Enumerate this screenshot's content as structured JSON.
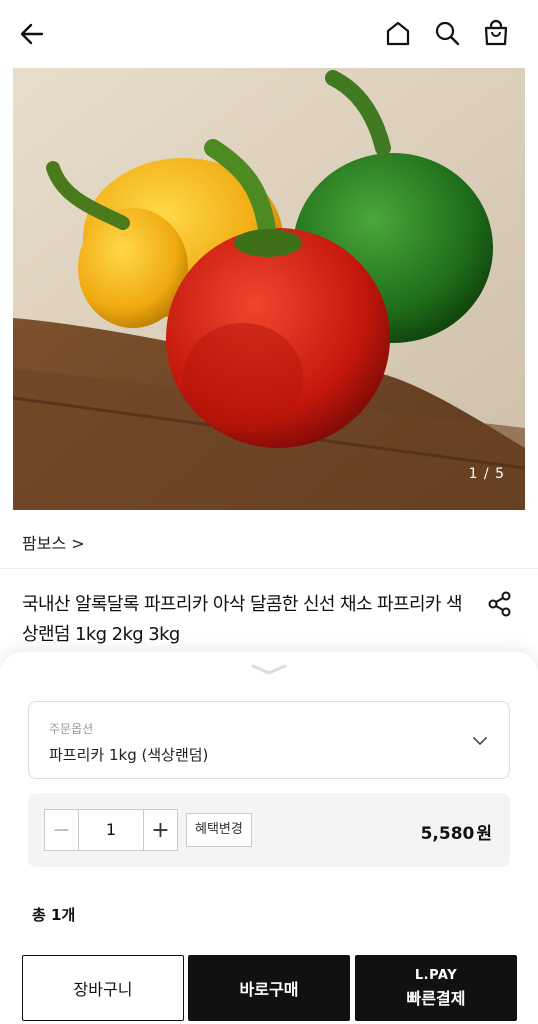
{
  "header": {
    "back_icon": "arrow-left-icon",
    "icons": [
      "home-icon",
      "search-icon",
      "shopping-bag-icon"
    ]
  },
  "gallery": {
    "counter": "1 / 5",
    "image": "red-yellow-green-bell-peppers-on-wooden-board"
  },
  "product": {
    "brand": "팜보스 >",
    "title": "국내산 알록달록 파프리카 아삭 달콤한 신선 채소 파프리카 색상랜덤 1kg 2kg 3kg",
    "share_icon": "share-icon"
  },
  "sheet": {
    "option_label": "주문옵션",
    "option_value": "파프리카 1kg (색상랜덤)",
    "quantity": "1",
    "minus": "−",
    "plus": "+",
    "benefit_button": "혜택변경",
    "price": "5,580",
    "price_unit": "원",
    "total": "총 1개",
    "buttons": {
      "cart": "장바구니",
      "buy_now": "바로구매",
      "lpay_line1": "L.PAY",
      "lpay_line2": "빠른결제"
    }
  },
  "colors": {
    "primary_button": "#111111",
    "sheet_bg": "#ffffff",
    "qty_area_bg": "#f4f4f4"
  }
}
